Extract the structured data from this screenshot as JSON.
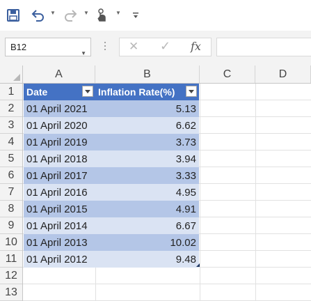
{
  "toolbar": {
    "icons": [
      "save-icon",
      "undo-icon",
      "redo-icon",
      "touch-mode-icon",
      "customize-icon"
    ]
  },
  "formula_bar": {
    "name_box": "B12",
    "cancel_glyph": "✕",
    "enter_glyph": "✓",
    "function_label": "fx",
    "formula": ""
  },
  "columns": [
    "A",
    "B",
    "C",
    "D"
  ],
  "rows": [
    "1",
    "2",
    "3",
    "4",
    "5",
    "6",
    "7",
    "8",
    "9",
    "10",
    "11",
    "12",
    "13"
  ],
  "table": {
    "headers": [
      "Date",
      "Inflation Rate(%)"
    ],
    "rows": [
      {
        "date": "01 April 2021",
        "rate": "5.13"
      },
      {
        "date": "01 April 2020",
        "rate": "6.62"
      },
      {
        "date": "01 April 2019",
        "rate": "3.73"
      },
      {
        "date": "01 April 2018",
        "rate": "3.94"
      },
      {
        "date": "01 April 2017",
        "rate": "3.33"
      },
      {
        "date": "01 April 2016",
        "rate": "4.95"
      },
      {
        "date": "01 April 2015",
        "rate": "4.91"
      },
      {
        "date": "01 April 2014",
        "rate": "6.67"
      },
      {
        "date": "01 April 2013",
        "rate": "10.02"
      },
      {
        "date": "01 April 2012",
        "rate": "9.48"
      }
    ]
  },
  "colors": {
    "header_fill": "#4472c4",
    "band_dark": "#b4c6e7",
    "band_light": "#dae3f3",
    "save_icon": "#3b5f9e"
  }
}
